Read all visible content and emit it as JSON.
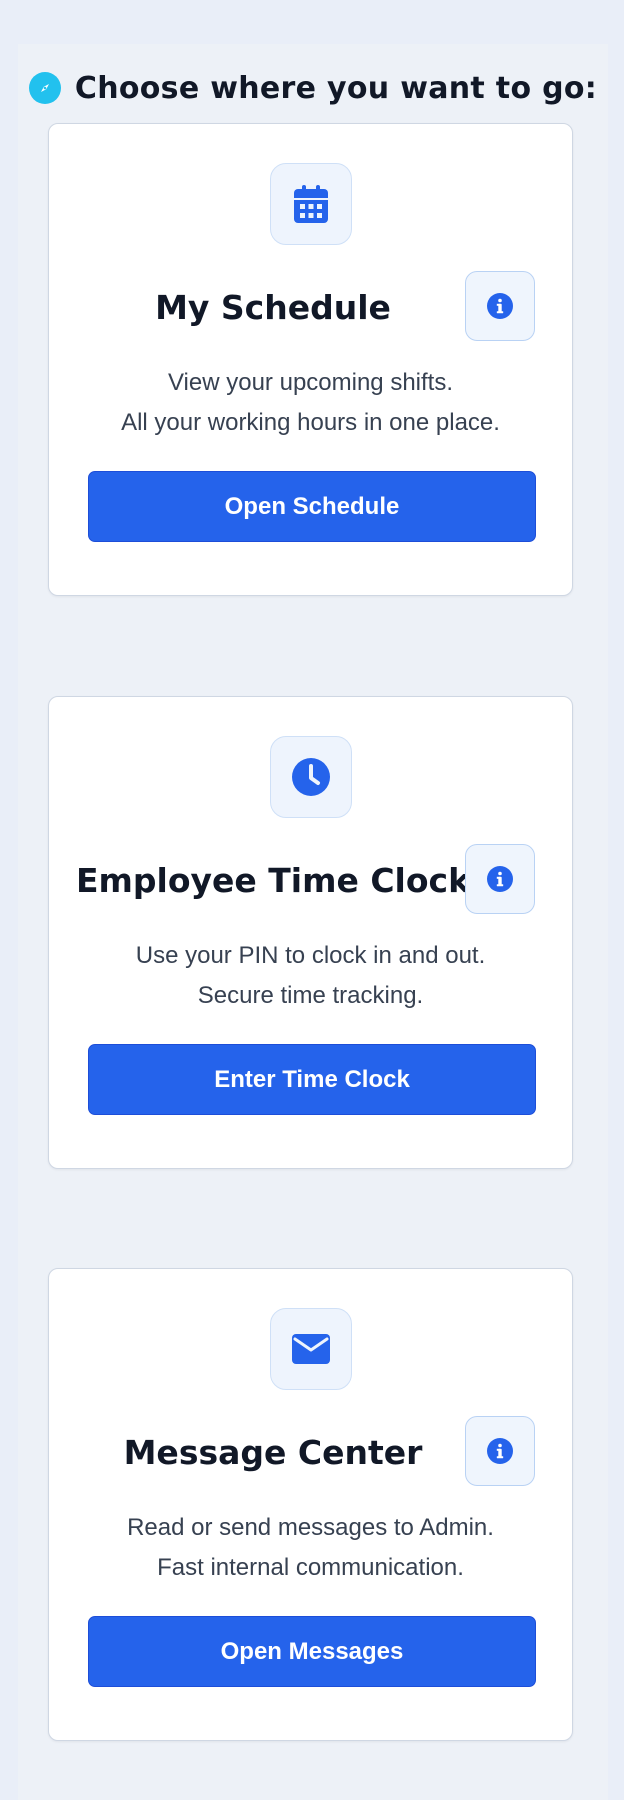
{
  "header": {
    "title": "Choose where you want to go:",
    "icon": "compass-icon"
  },
  "cards": [
    {
      "title": "My Schedule",
      "icon": "calendar-icon",
      "description": [
        "View your upcoming shifts.",
        "All your working hours in one place."
      ],
      "button_label": "Open Schedule"
    },
    {
      "title": "Employee Time Clock",
      "icon": "clock-icon",
      "description": [
        "Use your PIN to clock in and out.",
        "Secure time tracking."
      ],
      "button_label": "Enter Time Clock"
    },
    {
      "title": "Message Center",
      "icon": "envelope-icon",
      "description": [
        "Read or send messages to Admin.",
        "Fast internal communication."
      ],
      "button_label": "Open Messages"
    }
  ],
  "colors": {
    "accent": "#2563eb",
    "compass": "#22c1ee",
    "background": "#e9eef8",
    "card_background": "#ffffff"
  }
}
